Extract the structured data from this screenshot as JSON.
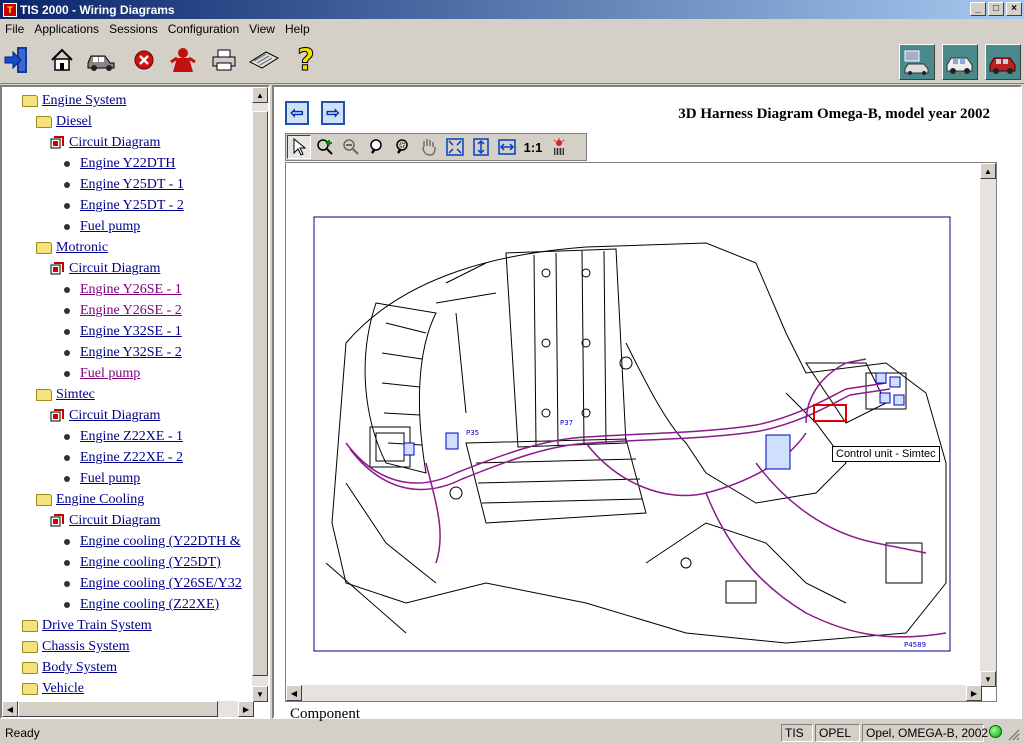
{
  "window": {
    "app_name": "TIS 2000",
    "title": "TIS 2000 - Wiring Diagrams",
    "min": "_",
    "max": "□",
    "close": "×"
  },
  "menu": [
    "File",
    "Applications",
    "Sessions",
    "Configuration",
    "View",
    "Help"
  ],
  "toolbar": {
    "left_icons": [
      "exit-icon",
      "home-icon",
      "vehicle-icon",
      "stop-icon",
      "user-icon",
      "print-icon",
      "keyboard-icon",
      "help-icon"
    ],
    "right_icons": [
      "vehicle-select-icon",
      "vehicle-list-icon",
      "vehicle-view-icon"
    ],
    "help_glyph": "?"
  },
  "tree": [
    {
      "label": "Engine System",
      "kind": "folder",
      "level": 1
    },
    {
      "label": "Diesel",
      "kind": "folder",
      "level": 2
    },
    {
      "label": "Circuit Diagram",
      "kind": "diagram",
      "level": 3
    },
    {
      "label": "Engine Y22DTH",
      "kind": "item",
      "level": 4
    },
    {
      "label": "Engine Y25DT - 1",
      "kind": "item",
      "level": 4
    },
    {
      "label": "Engine Y25DT - 2",
      "kind": "item",
      "level": 4
    },
    {
      "label": "Fuel pump",
      "kind": "item",
      "level": 4
    },
    {
      "label": "Motronic",
      "kind": "folder",
      "level": 2
    },
    {
      "label": "Circuit Diagram",
      "kind": "diagram",
      "level": 3
    },
    {
      "label": "Engine Y26SE - 1",
      "kind": "item",
      "level": 4,
      "visited": true
    },
    {
      "label": "Engine Y26SE - 2",
      "kind": "item",
      "level": 4,
      "visited": true
    },
    {
      "label": "Engine Y32SE - 1",
      "kind": "item",
      "level": 4
    },
    {
      "label": "Engine Y32SE - 2",
      "kind": "item",
      "level": 4
    },
    {
      "label": "Fuel pump",
      "kind": "item",
      "level": 4,
      "visited": true
    },
    {
      "label": "Simtec",
      "kind": "folder",
      "level": 2
    },
    {
      "label": "Circuit Diagram",
      "kind": "diagram",
      "level": 3
    },
    {
      "label": "Engine Z22XE - 1",
      "kind": "item",
      "level": 4
    },
    {
      "label": "Engine Z22XE - 2",
      "kind": "item",
      "level": 4
    },
    {
      "label": "Fuel pump",
      "kind": "item",
      "level": 4
    },
    {
      "label": "Engine Cooling",
      "kind": "folder",
      "level": 2
    },
    {
      "label": "Circuit Diagram",
      "kind": "diagram",
      "level": 3
    },
    {
      "label": "Engine cooling (Y22DTH &",
      "kind": "item",
      "level": 4
    },
    {
      "label": "Engine cooling (Y25DT)",
      "kind": "item",
      "level": 4
    },
    {
      "label": "Engine cooling (Y26SE/Y32",
      "kind": "item",
      "level": 4
    },
    {
      "label": "Engine cooling (Z22XE)",
      "kind": "item",
      "level": 4
    },
    {
      "label": "Drive Train System",
      "kind": "folder",
      "level": 1
    },
    {
      "label": "Chassis System",
      "kind": "folder",
      "level": 1
    },
    {
      "label": "Body System",
      "kind": "folder",
      "level": 1
    },
    {
      "label": "Vehicle",
      "kind": "folder",
      "level": 1
    }
  ],
  "diagram": {
    "title": "3D Harness Diagram Omega-B, model year 2002",
    "back_label": "⇦",
    "forward_label": "⇨",
    "viewer_tools": [
      "select-arrow-icon",
      "zoom-in-icon",
      "zoom-out-icon",
      "zoom-icon",
      "zoom-window-icon",
      "pan-hand-icon",
      "fit-all-icon",
      "fit-height-icon",
      "fit-width-icon",
      "actual-size-icon",
      "highlight-icon"
    ],
    "actual_size_label": "1:1",
    "tooltip": "Control unit - Simtec",
    "figure_ref": "P4589",
    "connector_labels": [
      "P35",
      "P37"
    ],
    "below_text": "Component"
  },
  "colors": {
    "harness": "#8b1a8b",
    "highlight": "#e00000",
    "link": "#00008b",
    "visited": "#800080",
    "accent": "#0000a0"
  },
  "status": {
    "text": "Ready",
    "app": "TIS",
    "make": "OPEL",
    "vehicle": "Opel, OMEGA-B, 2002"
  }
}
